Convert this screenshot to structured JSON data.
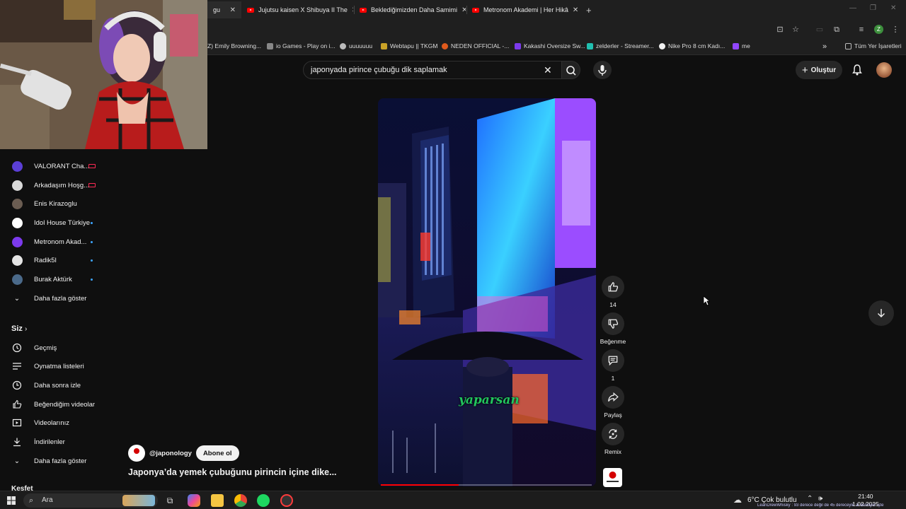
{
  "browser": {
    "tabs": [
      {
        "label": "gu",
        "active": true
      },
      {
        "label": "Jujutsu kaisen X Shibuya II The"
      },
      {
        "label": "Beklediğimizden Daha Samimi"
      },
      {
        "label": "Metronom Akademi | Her Hikâ"
      }
    ],
    "new_tab": "+",
    "profile_letter": "Z",
    "bookmarks": [
      {
        "label": "Z) Emily Browning..."
      },
      {
        "label": "io Games - Play on i..."
      },
      {
        "label": "uuuuuuu"
      },
      {
        "label": "Webtapu || TKGM"
      },
      {
        "label": "NEDEN OFFICIAL -..."
      },
      {
        "label": "Kakashi Oversize Sw..."
      },
      {
        "label": "zelderler - Streamer..."
      },
      {
        "label": "Nike Pro 8 cm Kadı..."
      },
      {
        "label": "me"
      }
    ],
    "bookmarks_more": "»",
    "all_bookmarks": "Tüm Yer İşaretleri"
  },
  "header": {
    "search_query": "japonyada pirince çubuğu dik saplamak",
    "create_label": "Oluştur"
  },
  "sidebar": {
    "subscriptions": [
      {
        "name": "VALORANT Cha...",
        "status": "live",
        "color": "#5b3fd6"
      },
      {
        "name": "Arkadaşım Hoşg...",
        "status": "live",
        "color": "#d9d9d9"
      },
      {
        "name": "Enis Kirazoglu",
        "status": "",
        "color": "#6b5d52"
      },
      {
        "name": "Idol House Türkiye",
        "status": "new",
        "color": "#ffffff"
      },
      {
        "name": "Metronom Akad...",
        "status": "new",
        "color": "#7c3aed"
      },
      {
        "name": "Radik5l",
        "status": "new",
        "color": "#e5e5e5"
      },
      {
        "name": "Burak Aktürk",
        "status": "new",
        "color": "#4b6a8a"
      }
    ],
    "show_more": "Daha fazla göster",
    "you_heading": "Siz",
    "you_items": [
      {
        "label": "Geçmiş",
        "icon": "history-icon"
      },
      {
        "label": "Oynatma listeleri",
        "icon": "playlists-icon"
      },
      {
        "label": "Daha sonra izle",
        "icon": "watch-later-icon"
      },
      {
        "label": "Beğendiğim videolar",
        "icon": "liked-icon"
      },
      {
        "label": "Videolarınız",
        "icon": "your-videos-icon"
      },
      {
        "label": "İndirilenler",
        "icon": "downloads-icon"
      }
    ],
    "show_more_2": "Daha fazla göster",
    "explore_heading": "Keşfet"
  },
  "short": {
    "caption": "yaparsan",
    "channel_handle": "@japonology",
    "subscribe_label": "Abone ol",
    "title": "Japonya’da yemek çubuğunu pirincin içine dike...",
    "progress": 0.37,
    "actions": {
      "like_count": "14",
      "dislike_label": "Beğenme",
      "comment_count": "1",
      "share_label": "Paylaş",
      "remix_label": "Remix"
    }
  },
  "taskbar": {
    "search_placeholder": "Ara",
    "weather": "6°C  Çok bulutlu",
    "time": "21:40",
    "date": "1.02.2025",
    "ticker": "LeanDrewWhisky : 93 derece değil de 45 dereceyle al deniliyor işte"
  },
  "colors": {
    "background": "#0f0f0f",
    "accent_red": "#ff0000",
    "caption_green": "#22c55e"
  }
}
